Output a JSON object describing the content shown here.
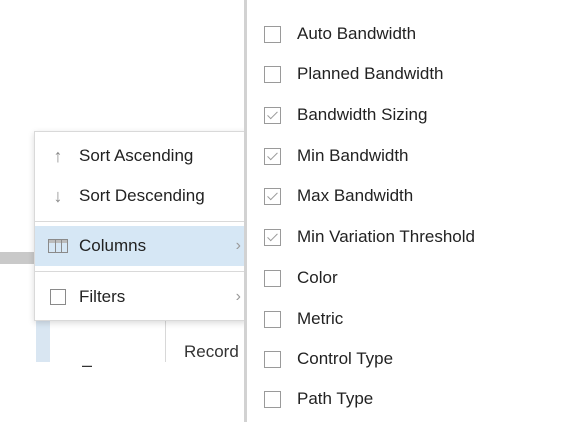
{
  "background": {
    "cell_dash": "–",
    "record_text": "Record"
  },
  "context_menu": {
    "items": [
      {
        "label": "Sort Ascending",
        "icon": "arrow-up-icon"
      },
      {
        "label": "Sort Descending",
        "icon": "arrow-down-icon"
      },
      {
        "label": "Columns",
        "icon": "columns-icon",
        "active": true,
        "submenu": true
      },
      {
        "label": "Filters",
        "icon": "filter-box-icon",
        "submenu": true
      }
    ],
    "chevron_glyph": "›",
    "arrow_up_glyph": "↑",
    "arrow_down_glyph": "↓"
  },
  "column_panel": {
    "options": [
      {
        "label": "Auto Bandwidth",
        "checked": false
      },
      {
        "label": "Planned Bandwidth",
        "checked": false
      },
      {
        "label": "Bandwidth Sizing",
        "checked": true
      },
      {
        "label": "Min Bandwidth",
        "checked": true
      },
      {
        "label": "Max Bandwidth",
        "checked": true
      },
      {
        "label": "Min Variation Threshold",
        "checked": true
      },
      {
        "label": "Color",
        "checked": false
      },
      {
        "label": "Metric",
        "checked": false
      },
      {
        "label": "Control Type",
        "checked": false
      },
      {
        "label": "Path Type",
        "checked": false
      }
    ]
  },
  "colors": {
    "active_item_bg": "#d6e7f5",
    "icon_gray": "#8a8a8a",
    "checkbox_border": "#9a9a9a"
  }
}
